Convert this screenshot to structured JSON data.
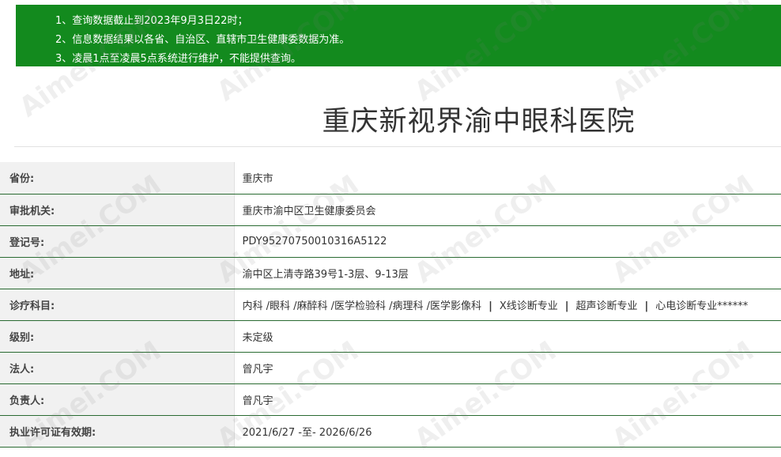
{
  "notice": {
    "lines": [
      "1、查询数据截止到2023年9月3日22时；",
      "2、信息数据结果以各省、自治区、直辖市卫生健康委数据为准。",
      "3、凌晨1点至凌晨5点系统进行维护，不能提供查询。"
    ]
  },
  "page_title": "重庆新视界渝中眼科医院",
  "rows": [
    {
      "label": "省份:",
      "value": "重庆市"
    },
    {
      "label": "审批机关:",
      "value": "重庆市渝中区卫生健康委员会"
    },
    {
      "label": "登记号:",
      "value": "PDY95270750010316A5122"
    },
    {
      "label": "地址:",
      "value": "渝中区上清寺路39号1-3层、9-13层"
    },
    {
      "label": "诊疗科目:",
      "segments": [
        "内科 /眼科 /麻醉科 /医学检验科 /病理科 /医学影像科",
        "X线诊断专业",
        "超声诊断专业",
        "心电诊断专业******"
      ]
    },
    {
      "label": "级别:",
      "value": "未定级"
    },
    {
      "label": "法人:",
      "value": "曾凡宇"
    },
    {
      "label": "负责人:",
      "value": "曾凡宇"
    },
    {
      "label": "执业许可证有效期:",
      "value": "2021/6/27 -至- 2026/6/26"
    }
  ],
  "separator": "|",
  "watermark": "Aimei.COM"
}
